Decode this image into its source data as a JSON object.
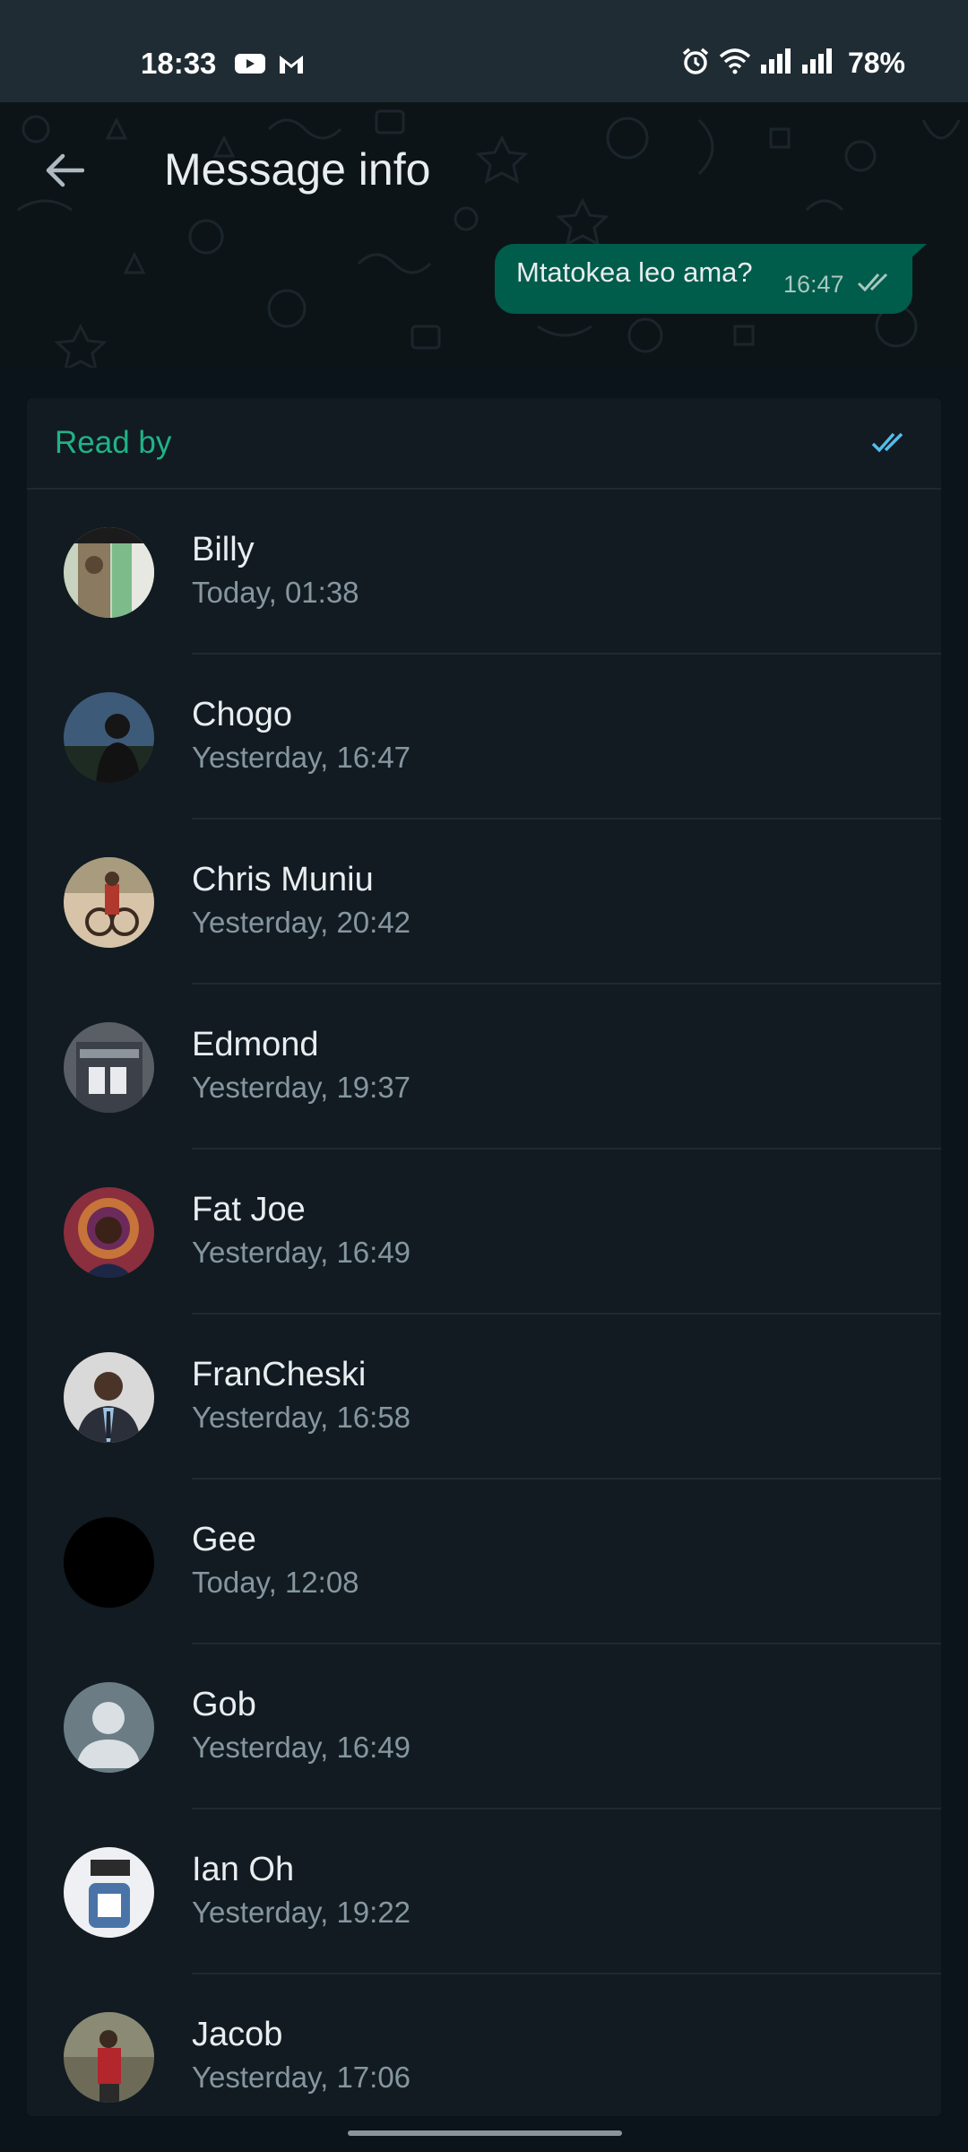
{
  "status_bar": {
    "time": "18:33",
    "left_icons": [
      "youtube-icon",
      "gmail-icon"
    ],
    "right_icons": [
      "alarm-icon",
      "wifi-icon",
      "signal-icon",
      "signal-icon"
    ],
    "battery": "78%"
  },
  "header": {
    "title": "Message info",
    "back_icon": "arrow-left-icon"
  },
  "message": {
    "text": "Mtatokea leo ama?",
    "time": "16:47",
    "status_icon": "double-check-icon",
    "bubble_color": "#005c4b"
  },
  "read_by": {
    "label": "Read by",
    "label_color": "#20b386",
    "tick_color": "#53bdeb",
    "contacts": [
      {
        "name": "Billy",
        "time": "Today, 01:38"
      },
      {
        "name": "Chogo",
        "time": "Yesterday, 16:47"
      },
      {
        "name": "Chris Muniu",
        "time": "Yesterday, 20:42"
      },
      {
        "name": "Edmond",
        "time": "Yesterday, 19:37"
      },
      {
        "name": "Fat Joe",
        "time": "Yesterday, 16:49"
      },
      {
        "name": "FranCheski",
        "time": "Yesterday, 16:58"
      },
      {
        "name": "Gee",
        "time": "Today, 12:08"
      },
      {
        "name": "Gob",
        "time": "Yesterday, 16:49"
      },
      {
        "name": "Ian Oh",
        "time": "Yesterday, 19:22"
      },
      {
        "name": "Jacob",
        "time": "Yesterday, 17:06"
      }
    ]
  },
  "colors": {
    "background": "#0b141a",
    "card": "#111b21",
    "status_bar": "#1f2c34",
    "secondary_text": "#8696a0"
  }
}
